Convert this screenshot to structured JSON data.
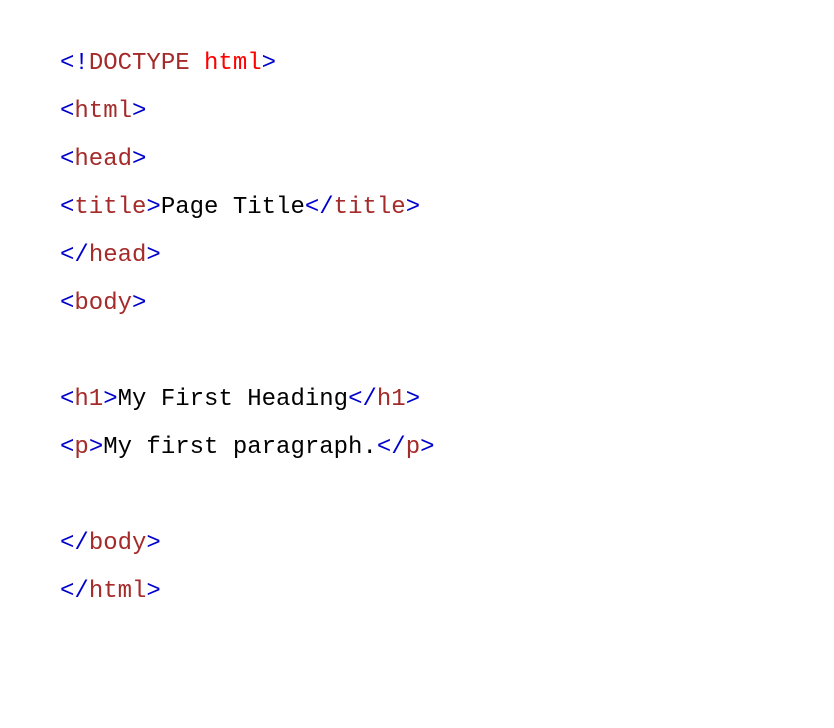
{
  "code": {
    "lines": [
      {
        "segments": [
          {
            "cls": "blue",
            "text": "<!"
          },
          {
            "cls": "brown",
            "text": "DOCTYPE "
          },
          {
            "cls": "red",
            "text": "html"
          },
          {
            "cls": "blue",
            "text": ">"
          }
        ]
      },
      {
        "segments": [
          {
            "cls": "blue",
            "text": "<"
          },
          {
            "cls": "brown",
            "text": "html"
          },
          {
            "cls": "blue",
            "text": ">"
          }
        ]
      },
      {
        "segments": [
          {
            "cls": "blue",
            "text": "<"
          },
          {
            "cls": "brown",
            "text": "head"
          },
          {
            "cls": "blue",
            "text": ">"
          }
        ]
      },
      {
        "segments": [
          {
            "cls": "blue",
            "text": "<"
          },
          {
            "cls": "brown",
            "text": "title"
          },
          {
            "cls": "blue",
            "text": ">"
          },
          {
            "cls": "black",
            "text": "Page Title"
          },
          {
            "cls": "blue",
            "text": "</"
          },
          {
            "cls": "brown",
            "text": "title"
          },
          {
            "cls": "blue",
            "text": ">"
          }
        ]
      },
      {
        "segments": [
          {
            "cls": "blue",
            "text": "</"
          },
          {
            "cls": "brown",
            "text": "head"
          },
          {
            "cls": "blue",
            "text": ">"
          }
        ]
      },
      {
        "segments": [
          {
            "cls": "blue",
            "text": "<"
          },
          {
            "cls": "brown",
            "text": "body"
          },
          {
            "cls": "blue",
            "text": ">"
          }
        ]
      },
      {
        "segments": []
      },
      {
        "segments": [
          {
            "cls": "blue",
            "text": "<"
          },
          {
            "cls": "brown",
            "text": "h1"
          },
          {
            "cls": "blue",
            "text": ">"
          },
          {
            "cls": "black",
            "text": "My First Heading"
          },
          {
            "cls": "blue",
            "text": "</"
          },
          {
            "cls": "brown",
            "text": "h1"
          },
          {
            "cls": "blue",
            "text": ">"
          }
        ]
      },
      {
        "segments": [
          {
            "cls": "blue",
            "text": "<"
          },
          {
            "cls": "brown",
            "text": "p"
          },
          {
            "cls": "blue",
            "text": ">"
          },
          {
            "cls": "black",
            "text": "My first paragraph."
          },
          {
            "cls": "blue",
            "text": "</"
          },
          {
            "cls": "brown",
            "text": "p"
          },
          {
            "cls": "blue",
            "text": ">"
          }
        ]
      },
      {
        "segments": []
      },
      {
        "segments": [
          {
            "cls": "blue",
            "text": "</"
          },
          {
            "cls": "brown",
            "text": "body"
          },
          {
            "cls": "blue",
            "text": ">"
          }
        ]
      },
      {
        "segments": [
          {
            "cls": "blue",
            "text": "</"
          },
          {
            "cls": "brown",
            "text": "html"
          },
          {
            "cls": "blue",
            "text": ">"
          }
        ]
      }
    ]
  }
}
